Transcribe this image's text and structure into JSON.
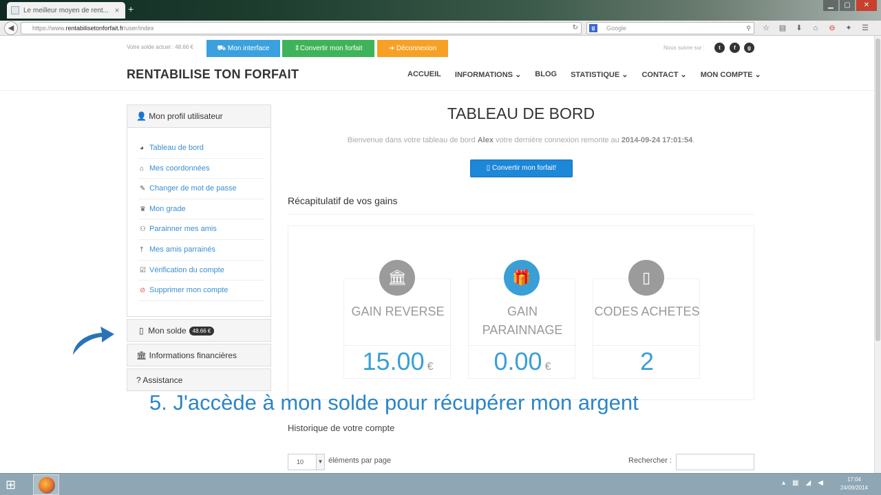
{
  "browser": {
    "tab_title": "Le meilleur moyen de rent...",
    "tab_close": "×",
    "new_tab": "+",
    "url_prefix": "https://www.",
    "url_domain": "rentabilisetonforfait.fr",
    "url_path": "/user/index",
    "search_placeholder": "Google",
    "search_engine_letter": "g"
  },
  "topbar": {
    "balance_text": "Votre solde actuel : 48.66 €",
    "buttons": [
      {
        "label": "Mon interface",
        "icon": "car-icon"
      },
      {
        "label": "Convertir mon forfait",
        "icon": "arrows-icon"
      },
      {
        "label": "Déconnexion",
        "icon": "logout-icon"
      }
    ],
    "follow_text": "Nous suivre sur :",
    "social": [
      "t",
      "f",
      "g"
    ]
  },
  "header": {
    "brand": "RENTABILISE TON FORFAIT",
    "menu": [
      "ACCUEIL",
      "INFORMATIONS ⌄",
      "BLOG",
      "STATISTIQUE ⌄",
      "CONTACT ⌄",
      "MON COMPTE ⌄"
    ]
  },
  "sidebar": {
    "profile_title": "Mon profil utilisateur",
    "items": [
      {
        "label": "Tableau de bord",
        "icon": "dashboard-icon",
        "glyph": "◕"
      },
      {
        "label": "Mes coordonnées",
        "icon": "home-icon",
        "glyph": "⌂"
      },
      {
        "label": "Changer de mot de passe",
        "icon": "edit-icon",
        "glyph": "✎"
      },
      {
        "label": "Mon grade",
        "icon": "trophy-icon",
        "glyph": "♛"
      },
      {
        "label": "Parainner mes amis",
        "icon": "group-icon",
        "glyph": "⚇"
      },
      {
        "label": "Mes amis parrainés",
        "icon": "person-icon",
        "glyph": "†"
      },
      {
        "label": "Vérification du compte",
        "icon": "check-icon",
        "glyph": "☑"
      },
      {
        "label": "Supprimer mon compte",
        "icon": "ban-icon",
        "glyph": "⊘"
      }
    ],
    "solde_title": "Mon solde",
    "solde_badge": "48.66 €",
    "finances_title": "Informations financières",
    "assistance_title": "Assistance"
  },
  "main": {
    "title": "TABLEAU DE BORD",
    "welcome_prefix": "Bienvenue dans votre tableau de bord",
    "welcome_user": "Alex",
    "welcome_mid": "votre dernière connexion remonte au",
    "welcome_date": "2014-09-24 17:01:54",
    "welcome_end": ".",
    "convert_button": "Convertir mon forfait!",
    "recap_title": "Récapitulatif de vos gains",
    "stats": [
      {
        "label": "GAIN REVERSE",
        "value": "15.00",
        "currency": "€",
        "icon": "bank-icon",
        "color": "#9b9b9b"
      },
      {
        "label": "GAIN PARAINNAGE",
        "value": "0.00",
        "currency": "€",
        "icon": "gift-icon",
        "color": "#3a9fd7"
      },
      {
        "label": "CODES ACHETES",
        "value": "2",
        "currency": "",
        "icon": "mobile-icon",
        "color": "#9b9b9b"
      }
    ],
    "caption": "5. J'accède à mon solde pour récupérer mon argent",
    "history_title": "Historique de votre compte",
    "per_page_value": "10",
    "per_page_label": "éléments par page",
    "search_label": "Rechercher :"
  },
  "taskbar": {
    "time": "17:04",
    "date": "24/09/2014"
  }
}
